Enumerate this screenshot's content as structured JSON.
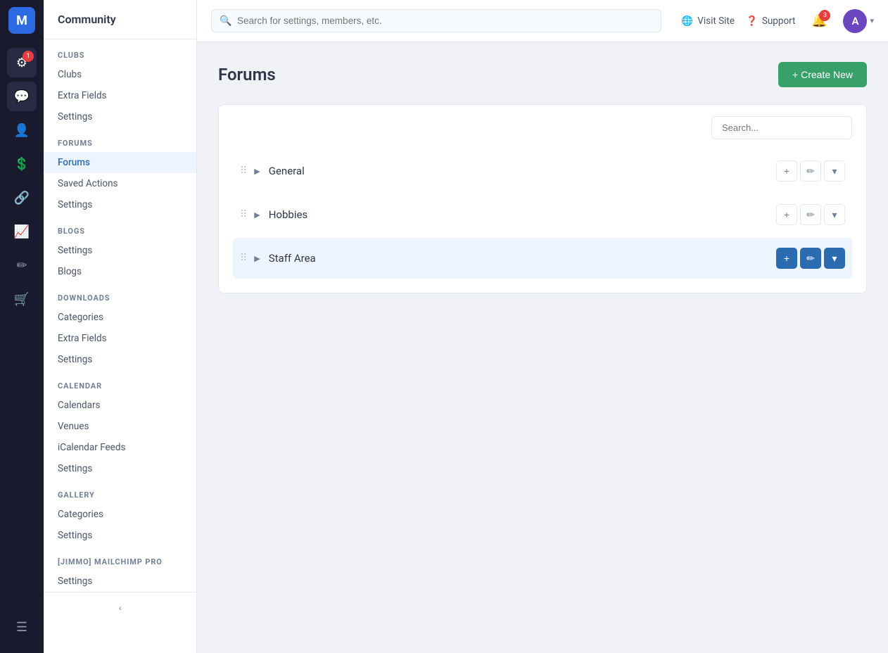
{
  "iconbar": {
    "logo": "M",
    "items": [
      {
        "name": "settings-icon",
        "icon": "⚙",
        "badge": 1
      },
      {
        "name": "community-icon",
        "icon": "💬",
        "badge": null
      },
      {
        "name": "members-icon",
        "icon": "👤",
        "badge": null
      },
      {
        "name": "billing-icon",
        "icon": "💲",
        "badge": null
      },
      {
        "name": "integrations-icon",
        "icon": "🔗",
        "badge": null
      },
      {
        "name": "analytics-icon",
        "icon": "📈",
        "badge": null
      },
      {
        "name": "design-icon",
        "icon": "✏",
        "badge": null
      },
      {
        "name": "store-icon",
        "icon": "🛒",
        "badge": null
      }
    ],
    "bottom": {
      "name": "menu-icon",
      "icon": "☰"
    }
  },
  "sidebar": {
    "title": "Community",
    "sections": [
      {
        "title": "CLUBS",
        "items": [
          {
            "label": "Clubs",
            "active": false
          },
          {
            "label": "Extra Fields",
            "active": false
          },
          {
            "label": "Settings",
            "active": false
          }
        ]
      },
      {
        "title": "FORUMS",
        "items": [
          {
            "label": "Forums",
            "active": true
          },
          {
            "label": "Saved Actions",
            "active": false
          },
          {
            "label": "Settings",
            "active": false
          }
        ]
      },
      {
        "title": "BLOGS",
        "items": [
          {
            "label": "Settings",
            "active": false
          },
          {
            "label": "Blogs",
            "active": false
          }
        ]
      },
      {
        "title": "DOWNLOADS",
        "items": [
          {
            "label": "Categories",
            "active": false
          },
          {
            "label": "Extra Fields",
            "active": false
          },
          {
            "label": "Settings",
            "active": false
          }
        ]
      },
      {
        "title": "CALENDAR",
        "items": [
          {
            "label": "Calendars",
            "active": false
          },
          {
            "label": "Venues",
            "active": false
          },
          {
            "label": "iCalendar Feeds",
            "active": false
          },
          {
            "label": "Settings",
            "active": false
          }
        ]
      },
      {
        "title": "GALLERY",
        "items": [
          {
            "label": "Categories",
            "active": false
          },
          {
            "label": "Settings",
            "active": false
          }
        ]
      },
      {
        "title": "[JIMMO] MAILCHIMP PRO",
        "items": [
          {
            "label": "Settings",
            "active": false
          }
        ]
      }
    ],
    "collapse_btn": "‹"
  },
  "topnav": {
    "search_placeholder": "Search for settings, members, etc.",
    "visit_site_label": "Visit Site",
    "support_label": "Support",
    "notification_count": "3",
    "avatar_letter": "A"
  },
  "page": {
    "title": "Forums",
    "create_new_label": "+ Create New",
    "search_placeholder": "Search...",
    "forums": [
      {
        "name": "General",
        "highlighted": false
      },
      {
        "name": "Hobbies",
        "highlighted": false
      },
      {
        "name": "Staff Area",
        "highlighted": true
      }
    ]
  }
}
